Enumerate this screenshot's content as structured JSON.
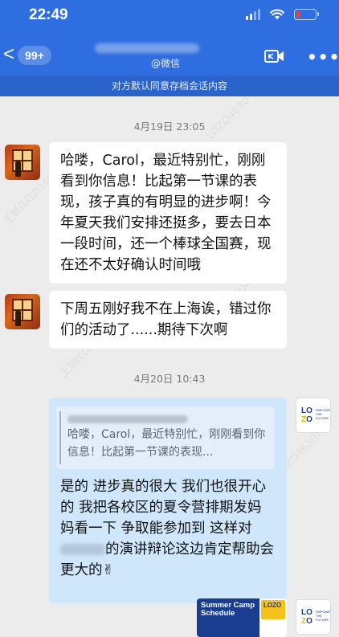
{
  "status_bar": {
    "time": "22:49"
  },
  "nav": {
    "badge_count": "99+",
    "contact_sub": "@微信",
    "back_glyph": "<",
    "more_glyph": "•••"
  },
  "notice": "对方默认同意存档会话内容",
  "messages": [
    {
      "type": "timestamp",
      "text": "4月19日 23:05"
    },
    {
      "type": "incoming",
      "text": "哈喽，Carol，最近特别忙，刚刚看到你信息！比起第一节课的表现，孩子真的有明显的进步啊！今年夏天我们安排还挺多，要去日本一段时间，还一个棒球全国赛，现在还不太好确认时间哦"
    },
    {
      "type": "incoming",
      "text": "下周五刚好我不在上海诶，错过你们的活动了......期待下次啊"
    },
    {
      "type": "timestamp",
      "text": "4月20日 10:43"
    },
    {
      "type": "outgoing",
      "quote_text": "哈喽，Carol，最近特别忙，刚刚看到你信息！比起第一节课的表现...",
      "text_before": "是的 进步真的很大 我们也很开心的 我把各校区的夏令营排期发妈妈看一下 争取能参加到 这样对",
      "text_after": "的演讲辩论这边肯定帮助会更大的✌"
    },
    {
      "type": "outgoing-card",
      "card_title": "Summer Camp Schedule",
      "card_logo": "LOZO"
    }
  ],
  "avatars": {
    "outgoing_logo": "LOZO",
    "outgoing_tagline": "EMPOWER THE FUTURE"
  },
  "watermarks": [
    "王慧(LOZO4630)",
    "LOZO4630",
    "王慧(LOZO4630)",
    "(LOZO4630)",
    "LOZO4630"
  ],
  "colors": {
    "header": "#2f6ee0",
    "notice": "#2a63c9",
    "outgoing_bubble": "#cfe6fb",
    "incoming_bubble": "#ffffff",
    "background": "#ececec"
  }
}
